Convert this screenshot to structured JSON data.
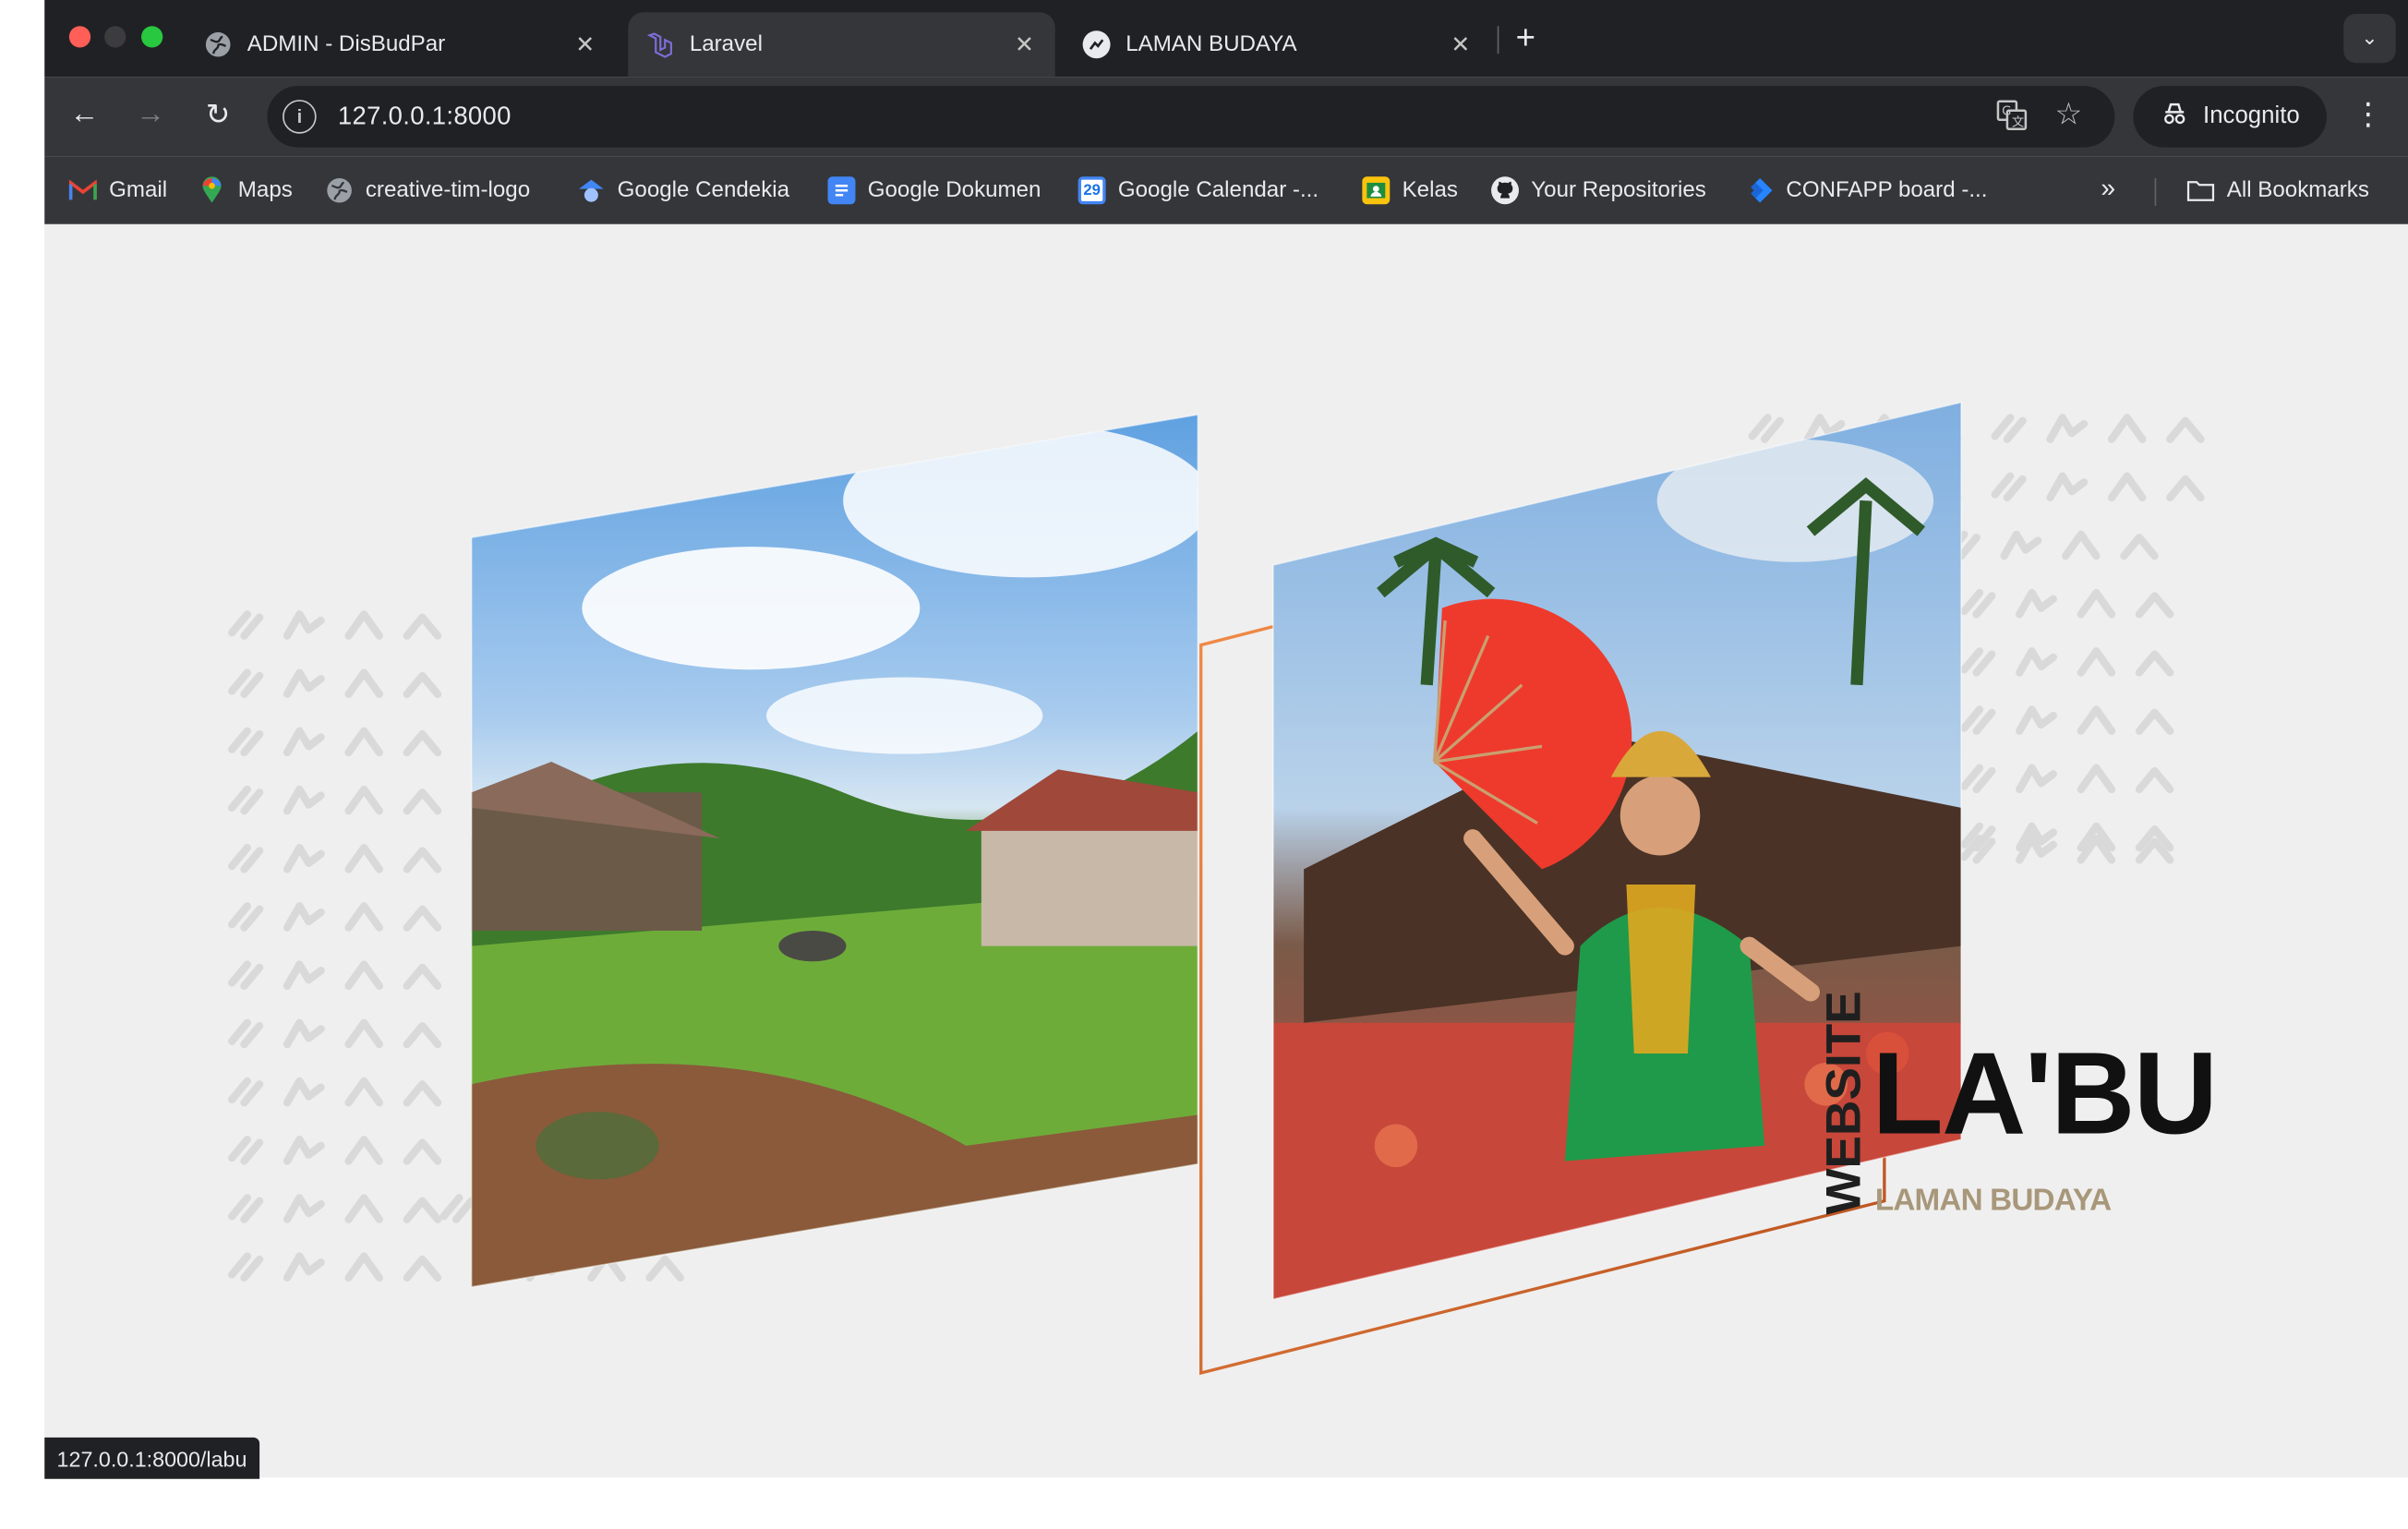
{
  "tabs": [
    {
      "label": "ADMIN - DisBudPar",
      "icon": "globe-icon"
    },
    {
      "label": "Laravel",
      "icon": "laravel-icon"
    },
    {
      "label": "LAMAN BUDAYA",
      "icon": "site-icon"
    }
  ],
  "toolbar": {
    "url": "127.0.0.1:8000",
    "incognito_label": "Incognito"
  },
  "bookmarks": [
    {
      "label": "Gmail",
      "icon": "gmail-icon"
    },
    {
      "label": "Maps",
      "icon": "maps-icon"
    },
    {
      "label": "creative-tim-logo",
      "icon": "globe-icon"
    },
    {
      "label": "Google Cendekia",
      "icon": "scholar-icon"
    },
    {
      "label": "Google Dokumen",
      "icon": "docs-icon"
    },
    {
      "label": "Google Calendar -...",
      "icon": "calendar-icon"
    },
    {
      "label": "Kelas",
      "icon": "classroom-icon"
    },
    {
      "label": "Your Repositories",
      "icon": "github-icon"
    },
    {
      "label": "CONFAPP board -...",
      "icon": "jira-icon"
    }
  ],
  "all_bookmarks_label": "All Bookmarks",
  "hero": {
    "vertical_label": "WEBSITE",
    "title": "LA'BU",
    "subtitle": "LAMAN BUDAYA"
  },
  "status_url": "127.0.0.1:8000/labu",
  "colors": {
    "accent_orange": "#e07a3a",
    "subtitle_gold": "#a8977a",
    "pattern_gray": "#d9d9d9",
    "tabstrip": "#202124",
    "toolbar": "#35363a"
  }
}
